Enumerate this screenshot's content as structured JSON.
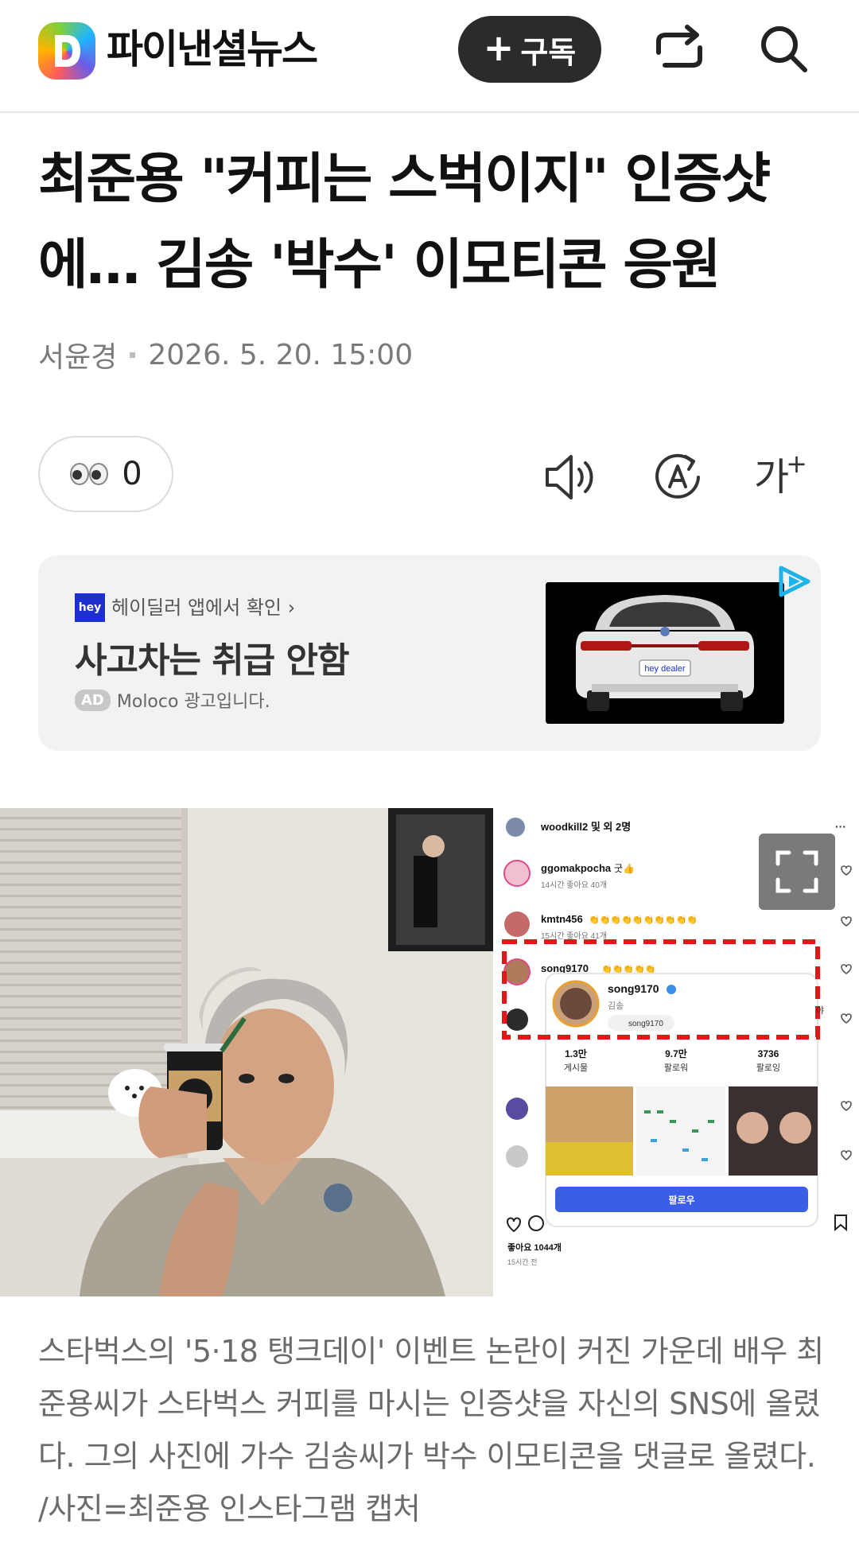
{
  "header": {
    "logo_letter": "D",
    "brand": "파이낸셜뉴스",
    "subscribe_plus": "+",
    "subscribe_label": "구독",
    "icons": [
      "share-icon",
      "search-icon"
    ]
  },
  "article": {
    "title": "최준용 \"커피는 스벅이지\" 인증샷에… 김송 '박수' 이모티콘 응원",
    "author": "서윤경",
    "datetime": "2026. 5. 20. 15:00",
    "reaction_count": "0",
    "tools": [
      "speaker-icon",
      "translate-icon",
      "font-size-icon"
    ],
    "font_tool_label": "가",
    "caption": "스타벅스의 '5·18 탱크데이' 이벤트 논란이 커진 가운데 배우 최준용씨가 스타벅스 커피를 마시는 인증샷을 자신의 SNS에 올렸다. 그의 사진에 가수 김송씨가 박수 이모티콘을 댓글로 올렸다. /사진=최준용 인스타그램 캡처"
  },
  "ad": {
    "badge": "hey",
    "source": "헤이딜러 앱에서 확인 ›",
    "headline": "사고차는 취급 안함",
    "ad_chip": "AD",
    "ad_text": "Moloco 광고입니다.",
    "plate": "hey dealer"
  },
  "photo": {
    "ig_header": "woodkill2 및 외 2명",
    "ig_more": "···",
    "comments": [
      {
        "user": "ggomakpocha",
        "text": "굿👍",
        "meta": "14시간  좋아요 40개"
      },
      {
        "user": "kmtn456",
        "text": "👏👏👏👏👏👏👏👏👏👏",
        "meta": "15시간  좋아요 41개"
      },
      {
        "user": "song9170",
        "text": "👏👏👏👏👏",
        "meta": ""
      }
    ],
    "profile": {
      "username": "song9170",
      "name": "김송",
      "threads": "song9170",
      "stats": [
        {
          "value": "1.3만",
          "label": "게시물"
        },
        {
          "value": "9.7만",
          "label": "팔로워"
        },
        {
          "value": "3736",
          "label": "팔로잉"
        }
      ],
      "follow": "팔로우"
    },
    "likes": "좋아요 1044개",
    "time": "15시간 전",
    "side_char": "야"
  }
}
